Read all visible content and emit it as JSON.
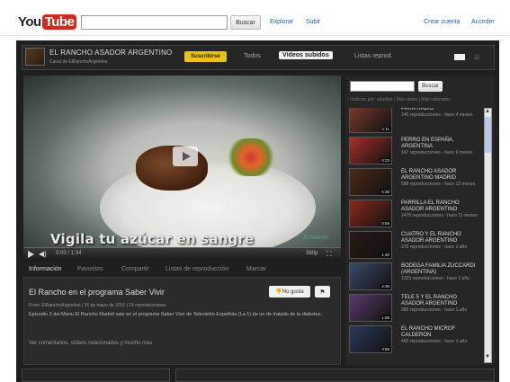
{
  "masthead": {
    "logo_you": "You",
    "logo_tube": "Tube",
    "search_button": "Buscar",
    "explore": "Explorar",
    "upload": "Subir",
    "create_account": "Crear cuenta",
    "sign_in": "Acceder"
  },
  "channel": {
    "title": "EL RANCHO ASADOR ARGENTINO",
    "subtitle": "Canal de ElRanchoArgentino",
    "subscribe": "Suscribirse",
    "tabs": [
      "Todos",
      "Vídeos subidos",
      "Listas reprod."
    ]
  },
  "player": {
    "overlay_text": "Vigila tu azúcar en sangre",
    "overlay_logo": "El Rancho",
    "time": "0:00 / 1:34",
    "quality": "360p"
  },
  "info": {
    "tabs": [
      "Información",
      "Favoritos",
      "Compartir",
      "Listas de reproducción",
      "Marcar"
    ],
    "video_title": "El Rancho en el programa Saber Vivir",
    "like_button": "No gusta",
    "uploader_line": "From: ElRanchoArgentino | 26 de mayo de 2010 | 29 reproducciones",
    "description": "Episodio 2 del Manu El Rancho Madrid sale en el programa Saber Vivir de Televisión Española (La 1) de un de tratado de la diabetes.",
    "comments_link": "Ver comentarios, vídeos relacionados y mucho más"
  },
  "sidebar": {
    "search_button": "Buscar",
    "filter": "Ordenar por: añadido | Más vistos | Más valorados",
    "items": [
      {
        "title": "PARA RADIO",
        "meta": "146 reproducciones - hace 4 meses",
        "duration": "1:11",
        "color": "#7a3a2a"
      },
      {
        "title": "PERRO EN ESPAÑA, ARGENTINA",
        "meta": "147 reproducciones - hace 6 meses",
        "duration": "0:23",
        "color": "#a4302a"
      },
      {
        "title": "EL RANCHO ASADOR ARGENTINO MADRID",
        "meta": "588 reproducciones - hace 12 meses",
        "duration": "5:30",
        "color": "#4a2a1a"
      },
      {
        "title": "PARRILLA EL RANCHO ASADOR ARGENTINO",
        "meta": "1476 reproducciones - hace 11 meses",
        "duration": "0:55",
        "color": "#8a2a1a"
      },
      {
        "title": "CUATRO Y EL RANCHO ASADOR ARGENTINO",
        "meta": "375 reproducciones - hace 1 año",
        "duration": "1:40",
        "color": "#2a1a12"
      },
      {
        "title": "BODEGA FAMILIA ZUCCARDI (ARGENTINA)",
        "meta": "1325 reproducciones - hace 1 año",
        "duration": "2:35",
        "color": "#3a4a6a"
      },
      {
        "title": "TELE 5 Y EL RANCHO ASADOR ARGENTINO",
        "meta": "980 reproducciones - hace 1 año",
        "duration": "1:05",
        "color": "#5a3a6a"
      },
      {
        "title": "EL RANCHO MICROF CALDERON",
        "meta": "492 reproducciones - hace 1 año",
        "duration": "3:55",
        "color": "#2a3a5a"
      }
    ]
  }
}
